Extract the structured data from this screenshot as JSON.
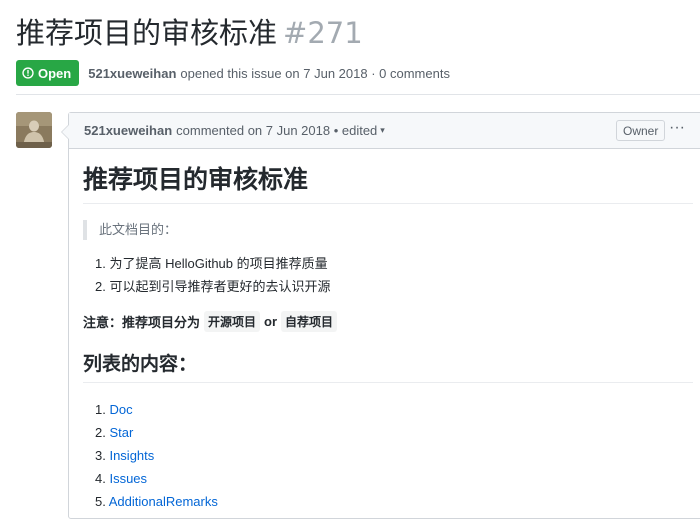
{
  "issue": {
    "title": "推荐项目的审核标准",
    "number": "#271",
    "state": "Open",
    "author": "521xueweihan",
    "meta": "opened this issue on 7 Jun 2018 · 0 comments"
  },
  "comment": {
    "author": "521xueweihan",
    "meta": "commented on 7 Jun 2018 • edited",
    "owner_label": "Owner",
    "menu_glyph": "···",
    "body": {
      "h1": "推荐项目的审核标准",
      "quote": "此文档目的：",
      "purposes": [
        {
          "num": "1.",
          "text": "为了提高 HelloGithub 的项目推荐质量"
        },
        {
          "num": "2.",
          "text": "可以起到引导推荐者更好的去认识开源"
        }
      ],
      "note_prefix": "注意：推荐项目分为",
      "note_code1": "开源项目",
      "note_or": "or",
      "note_code2": "自荐项目",
      "h2": "列表的内容：",
      "toc": [
        {
          "num": "1.",
          "label": "Doc"
        },
        {
          "num": "2.",
          "label": "Star"
        },
        {
          "num": "3.",
          "label": "Insights"
        },
        {
          "num": "4.",
          "label": "Issues"
        },
        {
          "num": "5.",
          "label": "AdditionalRemarks"
        }
      ]
    }
  },
  "icons": {
    "state": "issue-opened-icon",
    "caret": "caret-down-icon"
  },
  "colors": {
    "open_badge": "#28a745",
    "link": "#0366d6"
  }
}
